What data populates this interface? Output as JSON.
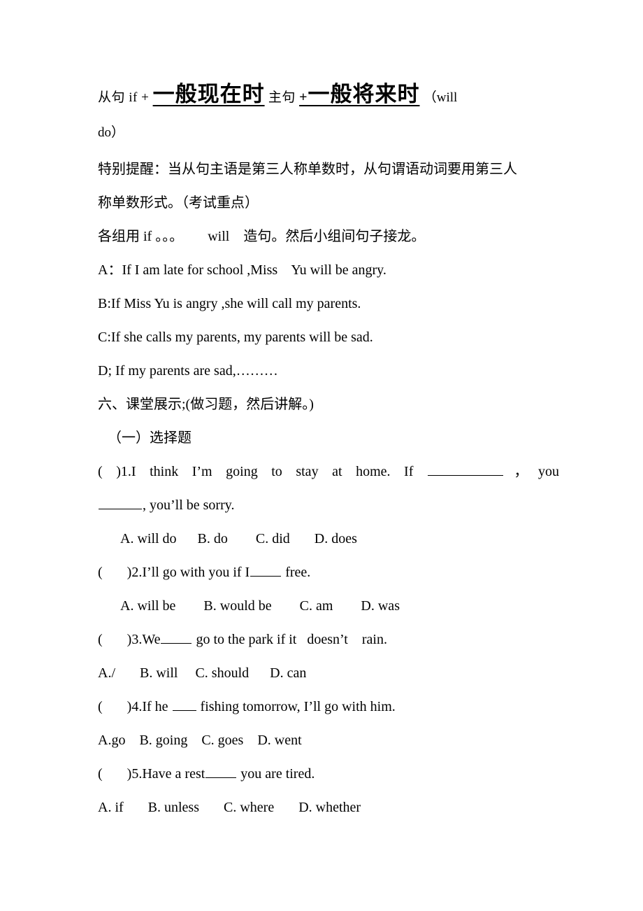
{
  "document": {
    "title_line": {
      "prefix": "从句 if +",
      "tense1": "一般现在时",
      "middle": "主句",
      "plus": "+",
      "tense2": "一般将来时",
      "suffix_open": "（will",
      "suffix_close": "do）"
    },
    "note": {
      "line1": "特别提醒：当从句主语是第三人称单数时，从句谓语动词要用第三人",
      "line2": "称单数形式。（考试重点）"
    },
    "activity": "各组用 if 。。。       will    造句。然后小组间句子接龙。",
    "examples": [
      "A：If I am late for school ,Miss    Yu will be angry.",
      "B:If Miss Yu is angry ,she will call my parents.",
      "C:If she calls my parents, my parents will be sad.",
      "D; If my parents are sad,………"
    ],
    "section_heading": "六、课堂展示;(做习题，然后讲解。)",
    "subsection_heading": "（一）选择题",
    "questions": [
      {
        "paren": "(          )",
        "number": "1.",
        "stem_part1": "I think I’m going to stay at home. If",
        "stem_part2": "，",
        "stem_part3": "you",
        "stem_line2": ", you’ll be sorry.",
        "options": "A. will do      B. do        C. did       D. does"
      },
      {
        "paren": "(       )",
        "number": "2.",
        "stem_part1": "I’ll go with you if I",
        "stem_part2": "free.",
        "options": "A. will be        B. would be        C. am        D. was"
      },
      {
        "paren": "(       )",
        "number": "3.",
        "stem_part1": "We",
        "stem_part2": "go to the park if it   doesn’t    rain.",
        "options": "A./       B. will     C. should      D. can"
      },
      {
        "paren": "(       )",
        "number": "4.",
        "stem_part1": "If he",
        "stem_part2": "fishing tomorrow, I’ll go with him.",
        "options": "A.go    B. going    C. goes    D. went"
      },
      {
        "paren": "(       )",
        "number": "5.",
        "stem_part1": "Have a rest",
        "stem_part2": "you are tired.",
        "options": "A. if       B. unless       C. where       D. whether"
      }
    ]
  }
}
